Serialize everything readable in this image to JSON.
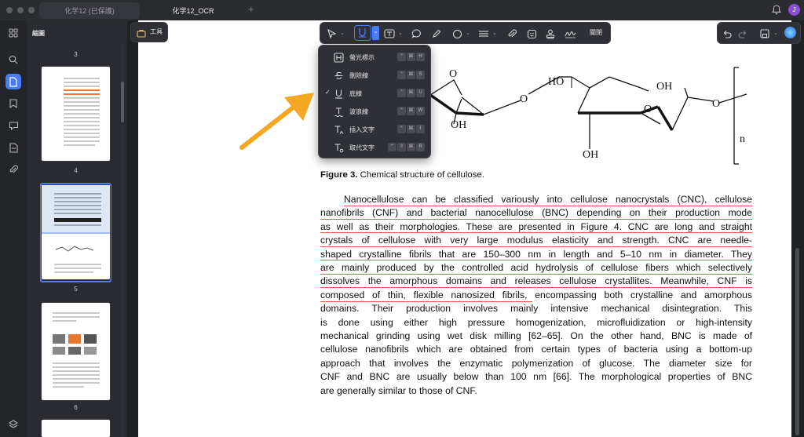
{
  "tabs": [
    {
      "label": "化学12 (已保護)",
      "active": false
    },
    {
      "label": "化学12_OCR",
      "active": true
    }
  ],
  "new_tab": "+",
  "user_avatar": "J",
  "sidebar": {
    "title": "縮圖"
  },
  "thumbnails": {
    "page_numbers": [
      "3",
      "4",
      "5",
      "6"
    ],
    "current_page": "5"
  },
  "tools_button": "工具",
  "toolbar": {
    "close_label": "關閉"
  },
  "menu": {
    "items": [
      {
        "label": "螢光標示",
        "checked": false,
        "icon": "highlight-icon",
        "keys": [
          "⌃",
          "⌘",
          "H"
        ]
      },
      {
        "label": "刪除線",
        "checked": false,
        "icon": "strikethrough-icon",
        "keys": [
          "⌃",
          "⌘",
          "S"
        ]
      },
      {
        "label": "底線",
        "checked": true,
        "icon": "underline-icon",
        "keys": [
          "⌃",
          "⌘",
          "U"
        ]
      },
      {
        "label": "波浪線",
        "checked": false,
        "icon": "squiggly-icon",
        "keys": [
          "⌃",
          "⌘",
          "W"
        ]
      },
      {
        "label": "插入文字",
        "checked": false,
        "icon": "insert-text-icon",
        "keys": [
          "⌃",
          "⌘",
          "I"
        ]
      },
      {
        "label": "取代文字",
        "checked": false,
        "icon": "replace-text-icon",
        "keys": [
          "⌃",
          "⇧",
          "⌘",
          "R"
        ]
      }
    ]
  },
  "figure": {
    "labels": {
      "ho_left": "HO",
      "oh_top": "OH",
      "oh_bottom": "OH",
      "oh_left_bottom": "OH",
      "o1": "O",
      "o2": "O",
      "o3": "O",
      "o4": "O",
      "n": "n"
    },
    "caption_bold": "Figure 3.",
    "caption_text": " Chemical structure of cellulose."
  },
  "paragraph": {
    "lines": [
      "Nanocellulose can be classified variously into cellulose nanocrystals (CNC), cellulose",
      "nanofibrils (CNF) and bacterial nanocellulose (BNC) depending on their production mode",
      "as well as their morphologies. These are presented in Figure 4. CNC are long and straight",
      "crystals of cellulose with very large modulus elasticity and strength. CNC are needle-",
      "shaped crystalline fibrils that are 150–300 nm in length and 5–10 nm in diameter. They",
      "are mainly produced by the controlled acid hydrolysis of cellulose fibers which selectively",
      "dissolves the amorphous domains and releases cellulose crystallites. Meanwhile, CNF is",
      "composed of thin, flexible nanosized fibrils, encompassing both crystalline and amorphous",
      "domains. Their production involves mainly intensive mechanical disintegration. This",
      "is done using either high pressure homogenization, microfluidization or high-intensity",
      "mechanical grinding using wet disk milling [62–65]. On the other hand, BNC is made of",
      "cellulose nanofibrils which are obtained from certain types of bacteria using a bottom-up",
      "approach that involves the enzymatic polymerization of glucose. The diameter size for",
      "CNF and BNC are usually below than 100 nm [66]. The morphological properties of BNC",
      "are generally similar to those of CNF."
    ]
  },
  "colors": {
    "accent": "#4a7cf7",
    "underline": "#e35b5b",
    "arrow": "#f5a623",
    "link": "#1a6fb5"
  }
}
